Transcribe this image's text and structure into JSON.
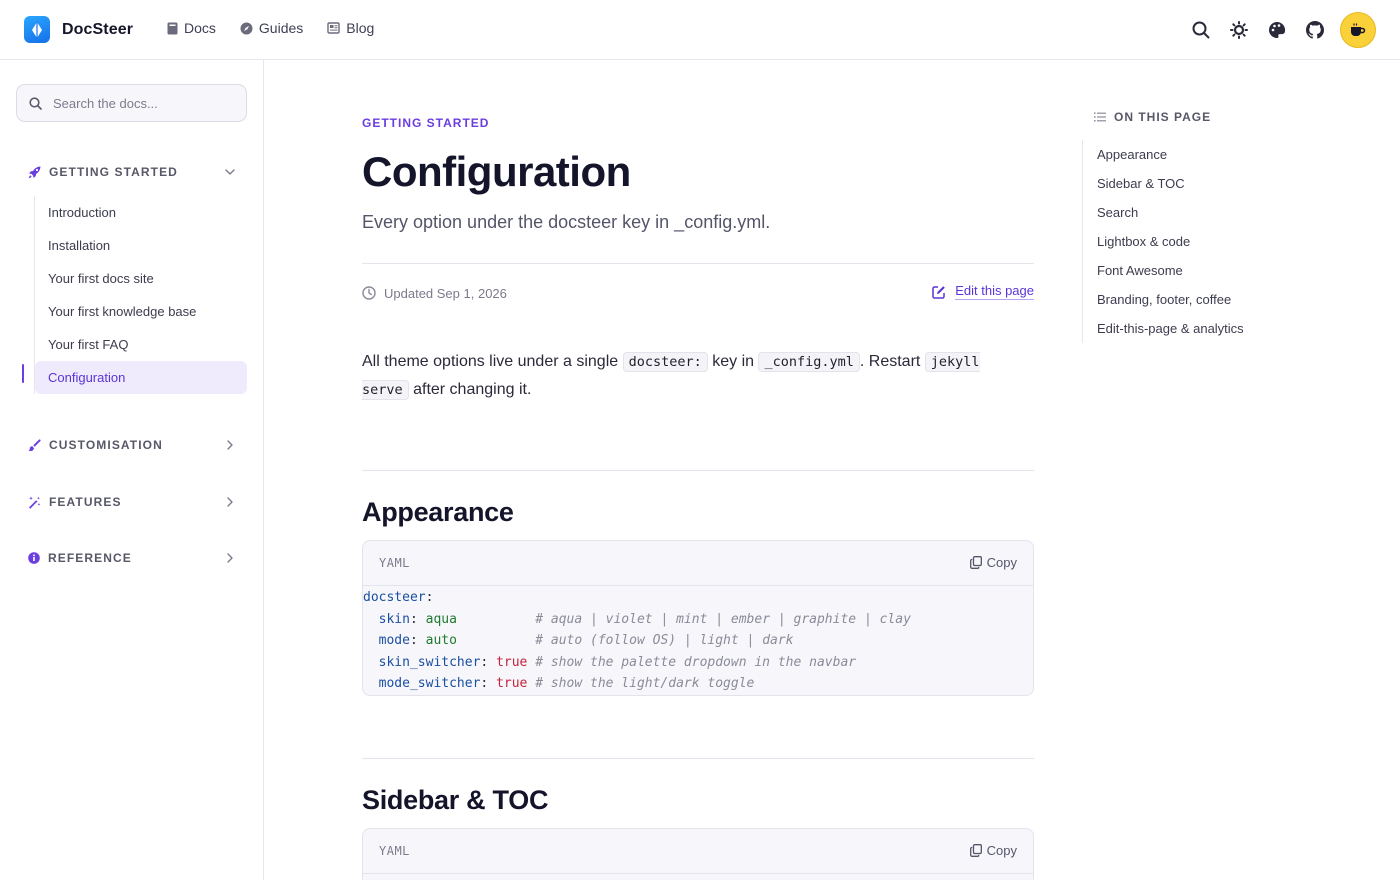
{
  "brand": {
    "name": "DocSteer"
  },
  "nav": {
    "links": [
      {
        "label": "Docs",
        "icon": "book-icon"
      },
      {
        "label": "Guides",
        "icon": "compass-icon"
      },
      {
        "label": "Blog",
        "icon": "newspaper-icon"
      }
    ],
    "actions": [
      "search-icon",
      "sun-icon",
      "palette-icon",
      "github-icon",
      "coffee-icon"
    ]
  },
  "sidebar": {
    "search_placeholder": "Search the docs...",
    "sections": [
      {
        "label": "GETTING STARTED",
        "icon": "rocket-icon",
        "expanded": true,
        "items": [
          {
            "label": "Introduction",
            "active": false
          },
          {
            "label": "Installation",
            "active": false
          },
          {
            "label": "Your first docs site",
            "active": false
          },
          {
            "label": "Your first knowledge base",
            "active": false
          },
          {
            "label": "Your first FAQ",
            "active": false
          },
          {
            "label": "Configuration",
            "active": true
          }
        ]
      },
      {
        "label": "CUSTOMISATION",
        "icon": "brush-icon",
        "expanded": false
      },
      {
        "label": "FEATURES",
        "icon": "magic-wand-icon",
        "expanded": false
      },
      {
        "label": "REFERENCE",
        "icon": "info-icon",
        "expanded": false
      }
    ]
  },
  "main": {
    "eyebrow": "GETTING STARTED",
    "title": "Configuration",
    "lead": "Every option under the docsteer key in _config.yml.",
    "updated": "Updated Sep 1, 2026",
    "edit_label": "Edit this page",
    "intro": {
      "t1": "All theme options live under a single",
      "c1": "docsteer:",
      "t2": "key in",
      "c2": "_config.yml",
      "t3": ". Restart",
      "c3": "jekyll serve",
      "t4": "after changing it."
    },
    "sections": [
      {
        "heading": "Appearance",
        "lang": "YAML",
        "copy_label": "Copy",
        "code": {
          "l0_key": "docsteer",
          "l1_key": "skin",
          "l1_val": "aqua",
          "l1_com": "# aqua | violet | mint | ember | graphite | clay",
          "l2_key": "mode",
          "l2_val": "auto",
          "l2_com": "# auto (follow OS) | light | dark",
          "l3_key": "skin_switcher",
          "l3_val": "true",
          "l3_com": "# show the palette dropdown in the navbar",
          "l4_key": "mode_switcher",
          "l4_val": "true",
          "l4_com": "# show the light/dark toggle"
        }
      },
      {
        "heading": "Sidebar & TOC",
        "lang": "YAML",
        "copy_label": "Copy"
      }
    ]
  },
  "toc": {
    "title": "ON THIS PAGE",
    "items": [
      "Appearance",
      "Sidebar & TOC",
      "Search",
      "Lightbox & code",
      "Font Awesome",
      "Branding, footer, coffee",
      "Edit-this-page & analytics"
    ]
  },
  "colors": {
    "accent": "#6b3ee0",
    "active_bg": "#efebfd",
    "coffee": "#fbd13a",
    "brand_blue": "#1570e8"
  }
}
